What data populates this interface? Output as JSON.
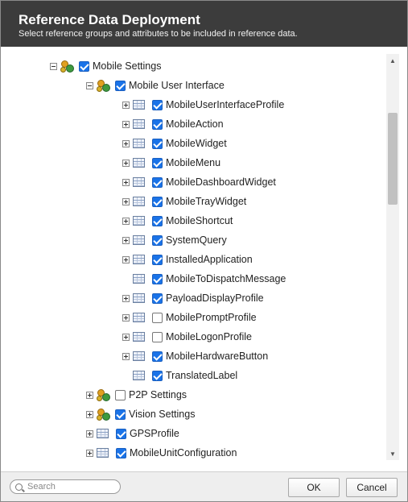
{
  "dialog": {
    "title": "Reference Data Deployment",
    "subtitle": "Select reference groups and attributes to be included in reference data."
  },
  "tree": [
    {
      "label": "Mobile Settings",
      "icon": "group-icon",
      "expander": "minus",
      "checked": true,
      "level": 0
    },
    {
      "label": "Mobile User Interface",
      "icon": "group-icon",
      "expander": "minus",
      "checked": true,
      "level": 1
    },
    {
      "label": "MobileUserInterfaceProfile",
      "icon": "table-icon",
      "expander": "plus",
      "checked": true,
      "level": 2
    },
    {
      "label": "MobileAction",
      "icon": "table-icon",
      "expander": "plus",
      "checked": true,
      "level": 2
    },
    {
      "label": "MobileWidget",
      "icon": "table-icon",
      "expander": "plus",
      "checked": true,
      "level": 2
    },
    {
      "label": "MobileMenu",
      "icon": "table-icon",
      "expander": "plus",
      "checked": true,
      "level": 2
    },
    {
      "label": "MobileDashboardWidget",
      "icon": "table-icon",
      "expander": "plus",
      "checked": true,
      "level": 2
    },
    {
      "label": "MobileTrayWidget",
      "icon": "table-icon",
      "expander": "plus",
      "checked": true,
      "level": 2
    },
    {
      "label": "MobileShortcut",
      "icon": "table-icon",
      "expander": "plus",
      "checked": true,
      "level": 2
    },
    {
      "label": "SystemQuery",
      "icon": "table-icon",
      "expander": "plus",
      "checked": true,
      "level": 2
    },
    {
      "label": "InstalledApplication",
      "icon": "table-icon",
      "expander": "plus",
      "checked": true,
      "level": 2
    },
    {
      "label": "MobileToDispatchMessage",
      "icon": "table-icon",
      "expander": "none",
      "checked": true,
      "level": 2
    },
    {
      "label": "PayloadDisplayProfile",
      "icon": "table-icon",
      "expander": "plus",
      "checked": true,
      "level": 2
    },
    {
      "label": "MobilePromptProfile",
      "icon": "table-icon",
      "expander": "plus",
      "checked": false,
      "level": 2
    },
    {
      "label": "MobileLogonProfile",
      "icon": "table-icon",
      "expander": "plus",
      "checked": false,
      "level": 2
    },
    {
      "label": "MobileHardwareButton",
      "icon": "table-icon",
      "expander": "plus",
      "checked": true,
      "level": 2
    },
    {
      "label": "TranslatedLabel",
      "icon": "table-icon",
      "expander": "none",
      "checked": true,
      "level": 2
    },
    {
      "label": "P2P Settings",
      "icon": "group-icon",
      "expander": "plus",
      "checked": false,
      "level": 1
    },
    {
      "label": "Vision Settings",
      "icon": "group-icon",
      "expander": "plus",
      "checked": true,
      "level": 1
    },
    {
      "label": "GPSProfile",
      "icon": "table-icon",
      "expander": "plus",
      "checked": true,
      "level": 1
    },
    {
      "label": "MobileUnitConfiguration",
      "icon": "table-icon",
      "expander": "plus",
      "checked": true,
      "level": 1
    }
  ],
  "footer": {
    "search_placeholder": "Search",
    "ok_label": "OK",
    "cancel_label": "Cancel"
  },
  "colors": {
    "header_bg": "#3c3c3c",
    "checkbox_checked": "#1a73e8"
  }
}
